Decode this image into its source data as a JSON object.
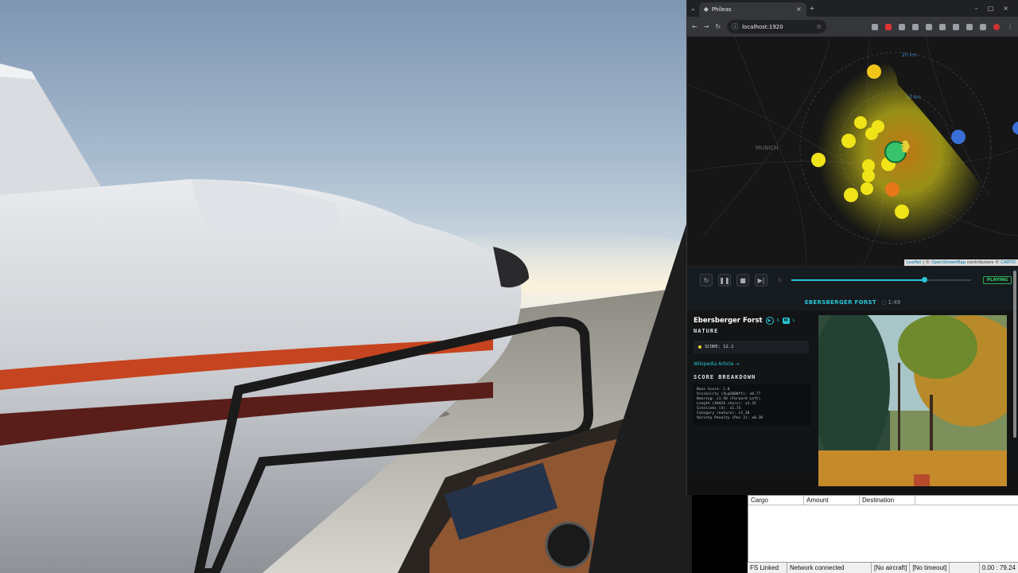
{
  "browser": {
    "tab_title": "Phileas",
    "url": "localhost:1920"
  },
  "map": {
    "attribution_leaflet": "Leaflet",
    "attribution_mid": " | © ",
    "attribution_osm": "OpenStreetMap",
    "attribution_tail": " contributors © ",
    "attribution_carto": "CARTO",
    "ring_inner_label": "10 km",
    "ring_outer_label": "20 km",
    "city_label": "MUNICH",
    "accent": "#25c6d6"
  },
  "player": {
    "elapsed": "0:",
    "state_badge": "PLAYING",
    "progress": 0.74,
    "now_title": "EBERSBERGER FORST",
    "now_time": "1:49"
  },
  "poi": {
    "title": "Ebersberger Forst",
    "chip_s": "S",
    "chip_m": "M",
    "chip_l": "L",
    "category": "NATURE",
    "score": "SCORE: 12.2",
    "wiki_link": "Wikipedia Article →",
    "breakdown_title": "SCORE BREAKDOWN",
    "breakdown_lines": [
      "Base Score: 1.0",
      "Visibility (XL@1000ft): x0.77",
      "Bearing: x1.50 (Forward Left)",
      "Length (49434 chars): x3.35",
      "Sitelinks (4): x1.73",
      "Category (nature): x1.30",
      "Variety Penalty (Pos 3): x0.30"
    ]
  },
  "cargo": {
    "headers": [
      "Cargo",
      "Amount",
      "Destination"
    ],
    "status": [
      "FS Linked",
      "Network connected",
      "[No aircraft]",
      "[No timeout]"
    ],
    "coords": "0.00 : 79.24"
  }
}
